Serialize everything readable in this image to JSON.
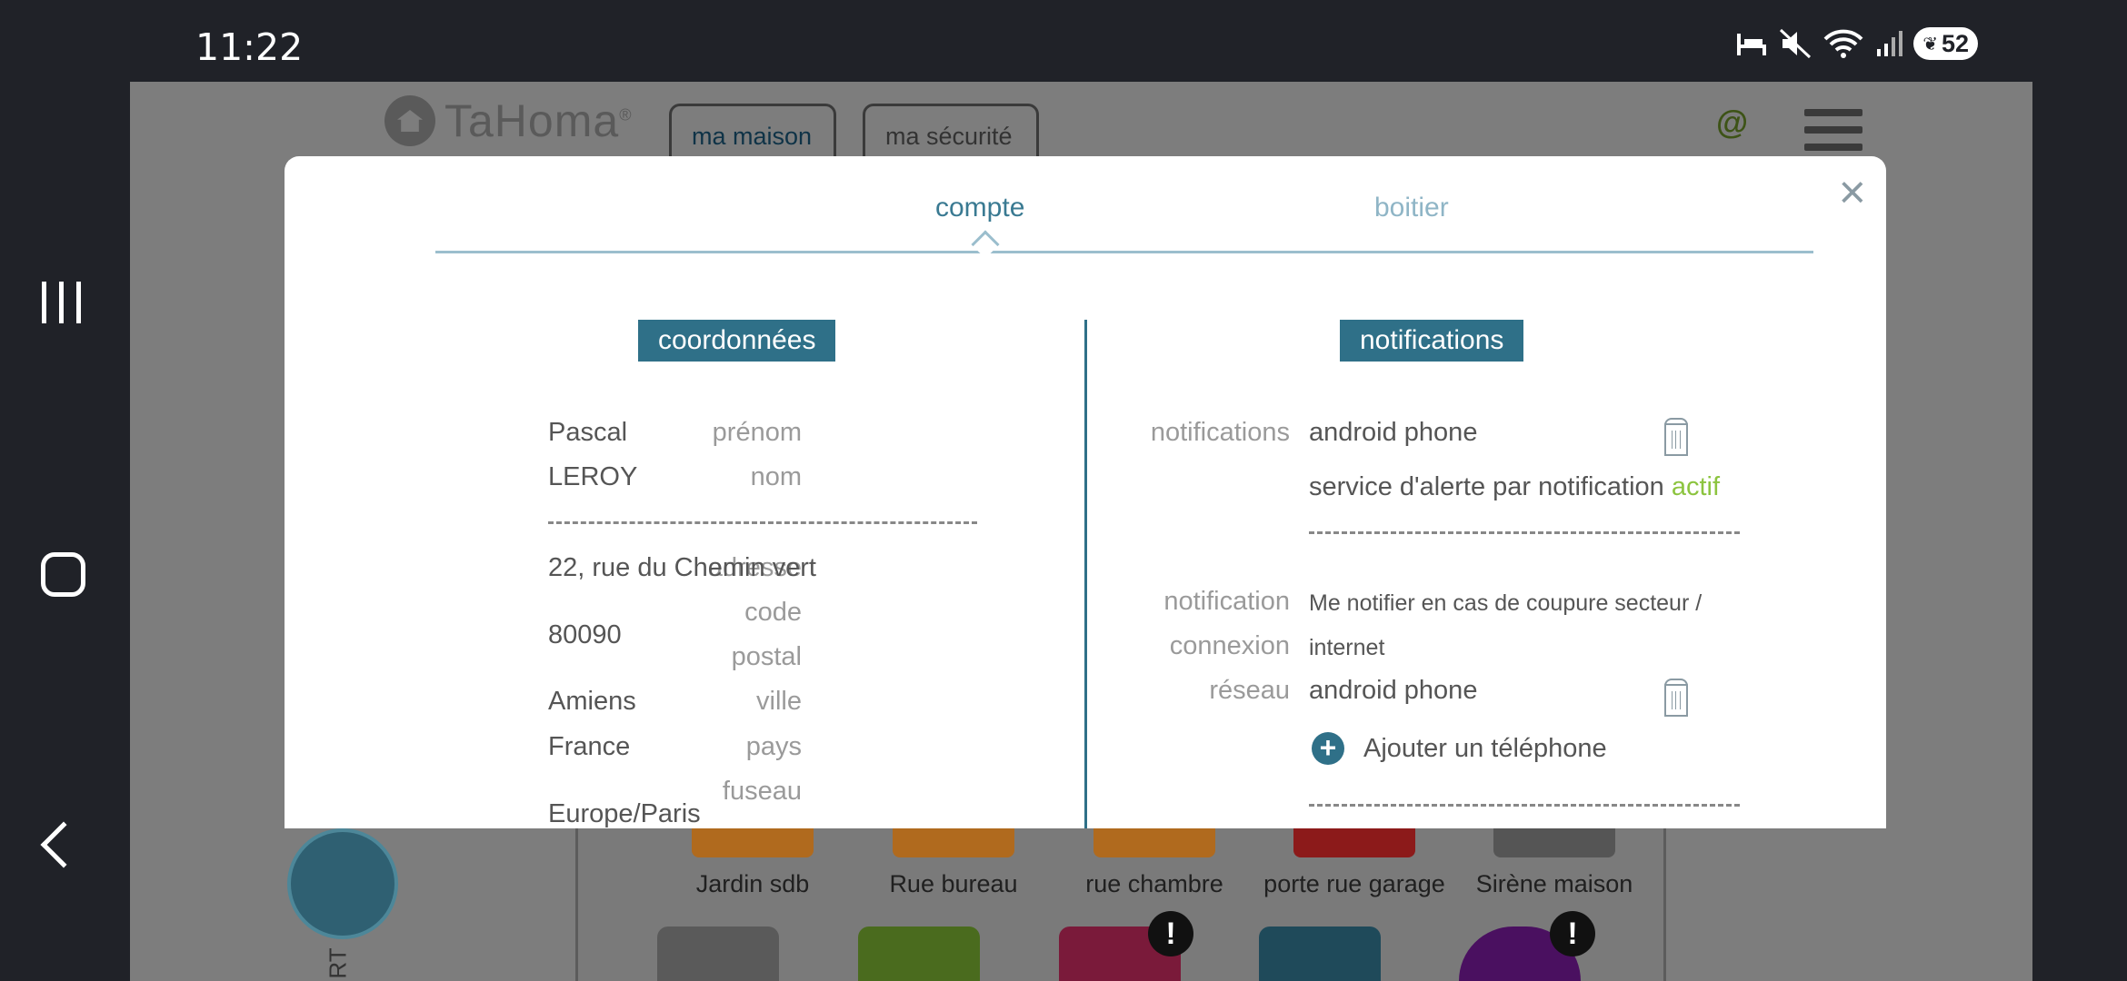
{
  "status_bar": {
    "time": "11:22",
    "battery": "52"
  },
  "app": {
    "logo": "TaHoma",
    "logo_mark": "®",
    "tabs": [
      "ma maison",
      "ma sécurité"
    ],
    "at_icon": "@",
    "devices": [
      "Jardin sdb",
      "Rue bureau",
      "rue chambre",
      "porte rue garage",
      "Sirène maison"
    ],
    "side_label": "RT",
    "alert_glyph": "!"
  },
  "modal": {
    "close": "×",
    "tabs": {
      "compte": "compte",
      "boitier": "boitier"
    },
    "left": {
      "title": "coordonnées",
      "fields": {
        "prenom_label": "prénom",
        "prenom": "Pascal",
        "nom_label": "nom",
        "nom": "LEROY",
        "adresse_label": "adresse",
        "adresse": "22, rue du Chemin vert",
        "code_label_1": "code",
        "code_label_2": "postal",
        "code": "80090",
        "ville_label": "ville",
        "ville": "Amiens",
        "pays_label": "pays",
        "pays": "France",
        "fuseau_label": "fuseau",
        "fuseau": "Europe/Paris"
      }
    },
    "right": {
      "title": "notifications",
      "notif_label": "notifications",
      "notif_device": "android phone",
      "alert_service": "service d'alerte par notification",
      "alert_status": "actif",
      "net_label_1": "notification",
      "net_label_2": "connexion",
      "net_label_3": "réseau",
      "net_text_1": "Me notifier en cas de coupure secteur /",
      "net_text_2": "internet",
      "net_device": "android phone",
      "add_phone": "Ajouter un téléphone",
      "plus": "+"
    }
  }
}
